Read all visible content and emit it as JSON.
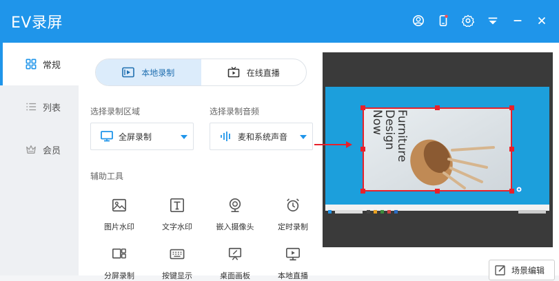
{
  "app": {
    "title": "EV录屏"
  },
  "titlebar": {
    "icons": [
      "user-icon",
      "phone-icon",
      "gear-icon",
      "menu-icon",
      "minimize-icon",
      "close-icon"
    ]
  },
  "sidebar": {
    "items": [
      {
        "label": "常规",
        "icon": "grid-icon",
        "active": true
      },
      {
        "label": "列表",
        "icon": "list-icon",
        "active": false
      },
      {
        "label": "会员",
        "icon": "crown-icon",
        "active": false
      }
    ]
  },
  "mode_tabs": [
    {
      "label": "本地录制",
      "icon": "record-icon",
      "active": true
    },
    {
      "label": "在线直播",
      "icon": "tv-icon",
      "active": false
    }
  ],
  "record_area": {
    "label": "选择录制区域",
    "value": "全屏录制"
  },
  "record_audio": {
    "label": "选择录制音频",
    "value": "麦和系统声音"
  },
  "tools": {
    "label": "辅助工具",
    "items": [
      "图片水印",
      "文字水印",
      "嵌入摄像头",
      "定时录制",
      "分屏录制",
      "按键显示",
      "桌面画板",
      "本地直播"
    ]
  },
  "preview": {
    "poster_text": [
      "Furniture",
      "Design",
      "Now"
    ]
  },
  "scene_button": {
    "label": "场景编辑"
  },
  "colors": {
    "accent": "#1f95ea",
    "selection": "#e8202a",
    "preview_bg": "#3a3a3a",
    "screen_bg": "#1c9fdc"
  }
}
